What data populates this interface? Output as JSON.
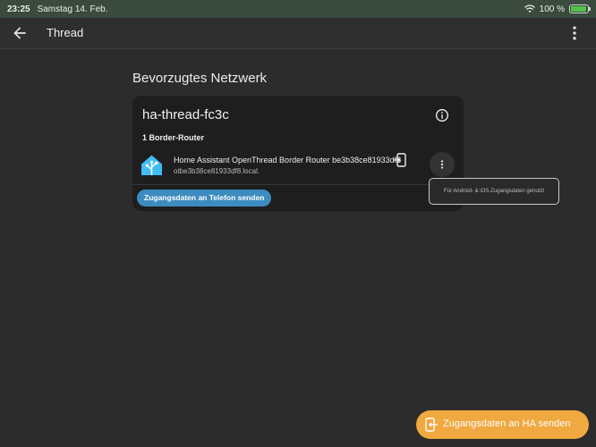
{
  "status": {
    "time": "23:25",
    "date": "Samstag 14. Feb.",
    "battery": "100 %",
    "battery_level": 1.0
  },
  "toolbar": {
    "title": "Thread",
    "back_icon": "arrow-left-icon",
    "menu_icon": "dots-vertical-icon"
  },
  "page": {
    "section_title": "Bevorzugtes Netzwerk",
    "network": {
      "name": "ha-thread-fc3c",
      "router_count_label": "1 Border-Router",
      "routers": [
        {
          "name": "Home Assistant OpenThread Border Router be3b38ce81933df8",
          "host": "otbe3b38ce81933df8.local."
        }
      ],
      "send_to_phone_label": "Zugangsdaten an Telefon senden"
    },
    "tooltip": "Für Android- & iOS-Zugangsdaten genutzt",
    "fab_label": "Zugangsdaten an HA senden"
  },
  "colors": {
    "accent_blue": "#3d8cbf",
    "accent_orange": "#f0a840",
    "card": "#1e1e1f",
    "background": "#2c2c2d"
  }
}
